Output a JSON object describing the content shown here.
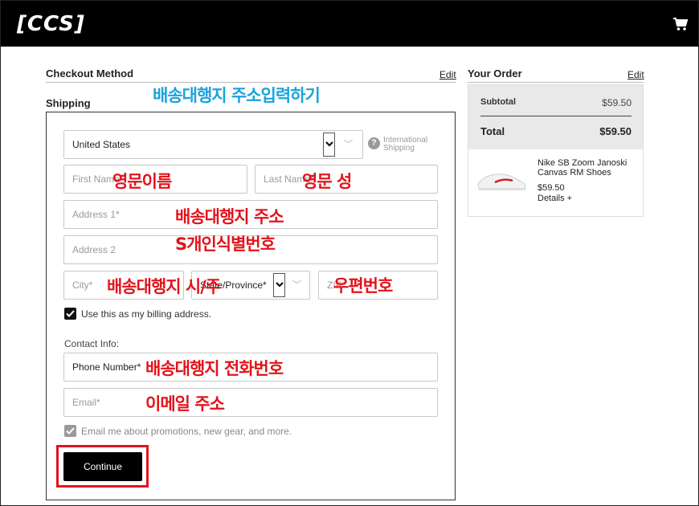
{
  "header": {
    "logo": "[CCS]",
    "cart_icon": "cart-icon"
  },
  "checkout_method": {
    "title": "Checkout Method",
    "edit": "Edit"
  },
  "shipping": {
    "title": "Shipping",
    "country": "United States",
    "international_line1": "International",
    "international_line2": "Shipping",
    "first_name_placeholder": "First Name*",
    "last_name_placeholder": "Last Name*",
    "address1_placeholder": "Address 1*",
    "address2_placeholder": "Address 2",
    "city_placeholder": "City*",
    "state_value": "State/Province*",
    "zip_placeholder": "ZIP*",
    "billing_checkbox_label": "Use this as my billing address.",
    "contact_label": "Contact Info:",
    "phone_placeholder": "Phone Number*",
    "email_placeholder": "Email*",
    "promo_checkbox_label": "Email me about promotions, new gear, and more.",
    "continue_label": "Continue"
  },
  "order": {
    "title": "Your Order",
    "edit": "Edit",
    "subtotal_label": "Subtotal",
    "subtotal_value": "$59.50",
    "total_label": "Total",
    "total_value": "$59.50",
    "item_name_line1": "Nike SB Zoom Janoski",
    "item_name_line2": "Canvas RM Shoes",
    "item_price": "$59.50",
    "details_link": "Details +"
  },
  "annotations": {
    "title": "배송대행지 주소입력하기",
    "first_name": "영문이름",
    "last_name": "영문 성",
    "address1": "배송대행지 주소",
    "address2": "S개인식별번호",
    "city_state": "배송대행지 시/주",
    "zip": "우편번호",
    "phone": "배송대행지 전화번호",
    "email": "이메일 주소"
  },
  "colors": {
    "annotation_red": "#e3131b",
    "annotation_blue": "#1aa3dd",
    "header_bg": "#000000"
  }
}
